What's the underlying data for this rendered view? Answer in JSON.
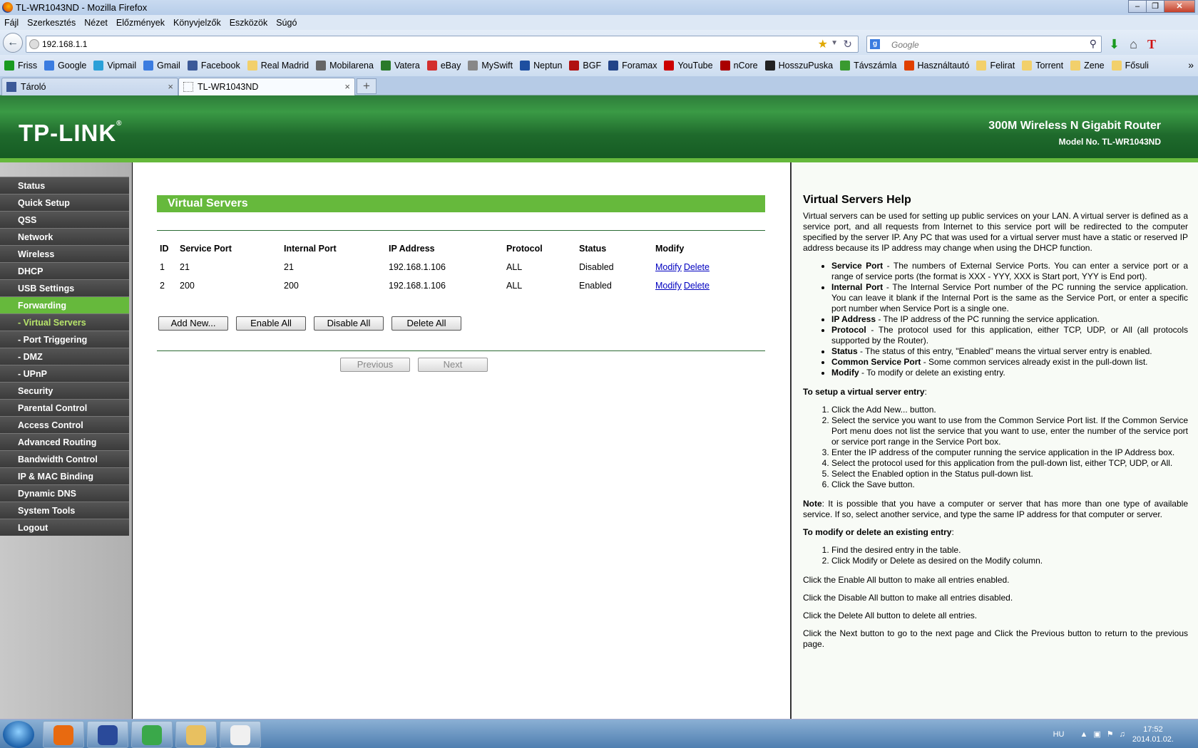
{
  "browser": {
    "window_title": "TL-WR1043ND - Mozilla Firefox",
    "menu": [
      "Fájl",
      "Szerkesztés",
      "Nézet",
      "Előzmények",
      "Könyvjelzők",
      "Eszközök",
      "Súgó"
    ],
    "url": "192.168.1.1",
    "search_placeholder": "Google",
    "bookmarks": [
      {
        "label": "Friss",
        "color": "#1a9a20"
      },
      {
        "label": "Google",
        "color": "#3b7ce0"
      },
      {
        "label": "Vipmail",
        "color": "#2aa0d8"
      },
      {
        "label": "Gmail",
        "color": "#3b7ce0"
      },
      {
        "label": "Facebook",
        "color": "#3b5998"
      },
      {
        "label": "Real Madrid",
        "color": "#f2d06b"
      },
      {
        "label": "Mobilarena",
        "color": "#666666"
      },
      {
        "label": "Vatera",
        "color": "#2a7a2a"
      },
      {
        "label": "eBay",
        "color": "#d32f2f"
      },
      {
        "label": "MySwift",
        "color": "#888888"
      },
      {
        "label": "Neptun",
        "color": "#1e4fa0"
      },
      {
        "label": "BGF",
        "color": "#b01010"
      },
      {
        "label": "Foramax",
        "color": "#224488"
      },
      {
        "label": "YouTube",
        "color": "#cc0000"
      },
      {
        "label": "nCore",
        "color": "#aa0000"
      },
      {
        "label": "HosszuPuska",
        "color": "#222222"
      },
      {
        "label": "Távszámla",
        "color": "#3a9a30"
      },
      {
        "label": "Használtautó",
        "color": "#e04000"
      },
      {
        "label": "Felirat",
        "color": "#f2d06b"
      },
      {
        "label": "Torrent",
        "color": "#f2d06b"
      },
      {
        "label": "Zene",
        "color": "#f2d06b"
      },
      {
        "label": "Fősuli",
        "color": "#f2d06b"
      }
    ],
    "bookmarks_more": "»",
    "tabs": [
      {
        "label": "Tároló",
        "active": false
      },
      {
        "label": "TL-WR1043ND",
        "active": true
      }
    ],
    "new_tab": "+"
  },
  "router": {
    "logo": "TP-LINK",
    "logo_mark": "®",
    "product": "300M Wireless N Gigabit Router",
    "model": "Model No. TL-WR1043ND",
    "accent_color": "#66b93c"
  },
  "menu": [
    {
      "label": "Status",
      "type": "main"
    },
    {
      "label": "Quick Setup",
      "type": "main"
    },
    {
      "label": "QSS",
      "type": "main"
    },
    {
      "label": "Network",
      "type": "main"
    },
    {
      "label": "Wireless",
      "type": "main"
    },
    {
      "label": "DHCP",
      "type": "main"
    },
    {
      "label": "USB Settings",
      "type": "main"
    },
    {
      "label": "Forwarding",
      "type": "active"
    },
    {
      "label": "- Virtual Servers",
      "type": "sub-active"
    },
    {
      "label": "- Port Triggering",
      "type": "sub"
    },
    {
      "label": "- DMZ",
      "type": "sub"
    },
    {
      "label": "- UPnP",
      "type": "sub"
    },
    {
      "label": "Security",
      "type": "main"
    },
    {
      "label": "Parental Control",
      "type": "main"
    },
    {
      "label": "Access Control",
      "type": "main"
    },
    {
      "label": "Advanced Routing",
      "type": "main"
    },
    {
      "label": "Bandwidth Control",
      "type": "main"
    },
    {
      "label": "IP & MAC Binding",
      "type": "main"
    },
    {
      "label": "Dynamic DNS",
      "type": "main"
    },
    {
      "label": "System Tools",
      "type": "main"
    },
    {
      "label": "Logout",
      "type": "main"
    }
  ],
  "main": {
    "title": "Virtual Servers",
    "columns": [
      "ID",
      "Service Port",
      "Internal Port",
      "IP Address",
      "Protocol",
      "Status",
      "Modify"
    ],
    "rows": [
      {
        "id": "1",
        "service_port": "21",
        "internal_port": "21",
        "ip": "192.168.1.106",
        "protocol": "ALL",
        "status": "Disabled",
        "modify": "Modify",
        "delete": "Delete"
      },
      {
        "id": "2",
        "service_port": "200",
        "internal_port": "200",
        "ip": "192.168.1.106",
        "protocol": "ALL",
        "status": "Enabled",
        "modify": "Modify",
        "delete": "Delete"
      }
    ],
    "buttons": {
      "add_new": "Add New...",
      "enable_all": "Enable All",
      "disable_all": "Disable All",
      "delete_all": "Delete All"
    },
    "pager": {
      "previous": "Previous",
      "next": "Next"
    }
  },
  "help": {
    "title": "Virtual Servers Help",
    "intro": "Virtual servers can be used for setting up public services on your LAN. A virtual server is defined as a service port, and all requests from Internet to this service port will be redirected to the computer specified by the server IP. Any PC that was used for a virtual server must have a static or reserved IP address because its IP address may change when using the DHCP function.",
    "bullets": [
      {
        "term": "Service Port",
        "text": " - The numbers of External Service Ports. You can enter a service port or a range of service ports (the format is XXX - YYY, XXX is Start port, YYY is End port)."
      },
      {
        "term": "Internal Port",
        "text": " - The Internal Service Port number of the PC running the service application. You can leave it blank if the Internal Port is the same as the Service Port, or enter a specific port number when Service Port is a single one."
      },
      {
        "term": "IP Address",
        "text": " - The IP address of the PC running the service application."
      },
      {
        "term": "Protocol",
        "text": " - The protocol used for this application, either TCP, UDP, or All (all protocols supported by the Router)."
      },
      {
        "term": "Status",
        "text": " - The status of this entry, \"Enabled\" means the virtual server entry is enabled."
      },
      {
        "term": "Common Service Port",
        "text": " - Some common services already exist in the pull-down list."
      },
      {
        "term": "Modify",
        "text": " - To modify or delete an existing entry."
      }
    ],
    "setup_heading": "To setup a virtual server entry",
    "setup_steps": [
      "Click the Add New... button.",
      "Select the service you want to use from the Common Service Port list. If the Common Service Port menu does not list the service that you want to use, enter the number of the service port or service port range in the Service Port box.",
      "Enter the IP address of the computer running the service application in the IP Address box.",
      "Select the protocol used for this application from the pull-down list, either TCP, UDP, or All.",
      "Select the Enabled option in the Status pull-down list.",
      "Click the Save button."
    ],
    "note_label": "Note",
    "note_text": ": It is possible that you have a computer or server that has more than one type of available service. If so, select another service, and type the same IP address for that computer or server.",
    "modify_heading": "To modify or delete an existing entry",
    "modify_steps": [
      "Find the desired entry in the table.",
      "Click Modify or Delete as desired on the Modify column."
    ],
    "enable_all_text": "Click the Enable All button to make all entries enabled.",
    "disable_all_text": "Click the Disable All button to make all entries disabled.",
    "delete_all_text": "Click the Delete All button to delete all entries.",
    "next_prev_text": "Click the Next button to go to the next page and Click the Previous button to return to the previous page."
  },
  "taskbar": {
    "apps": [
      {
        "name": "firefox-icon",
        "color": "#e86a10"
      },
      {
        "name": "save-icon",
        "color": "#2a4a9a"
      },
      {
        "name": "utorrent-icon",
        "color": "#3aa84a"
      },
      {
        "name": "explorer-folder-icon",
        "color": "#e8c060"
      },
      {
        "name": "paint-icon",
        "color": "#f0f0f0"
      }
    ],
    "language": "HU",
    "time": "17:52",
    "date": "2014.01.02."
  }
}
